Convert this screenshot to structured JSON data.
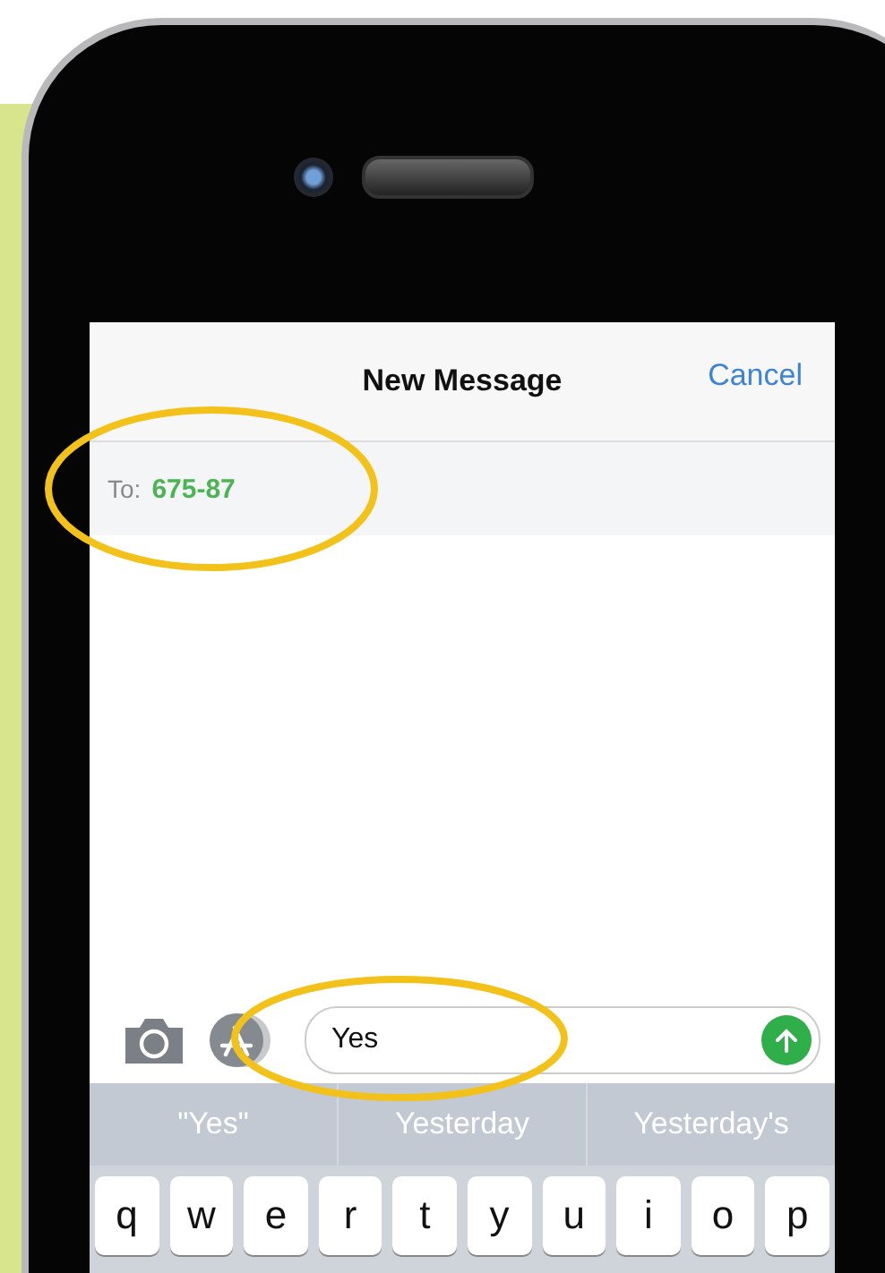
{
  "header": {
    "title": "New Message",
    "cancel": "Cancel"
  },
  "recipient": {
    "label": "To:",
    "value": "675-87"
  },
  "compose": {
    "value": "Yes"
  },
  "suggestions": [
    "\"Yes\"",
    "Yesterday",
    "Yesterday's"
  ],
  "keyboard_row": [
    "q",
    "w",
    "e",
    "r",
    "t",
    "y",
    "u",
    "i",
    "o",
    "p"
  ]
}
